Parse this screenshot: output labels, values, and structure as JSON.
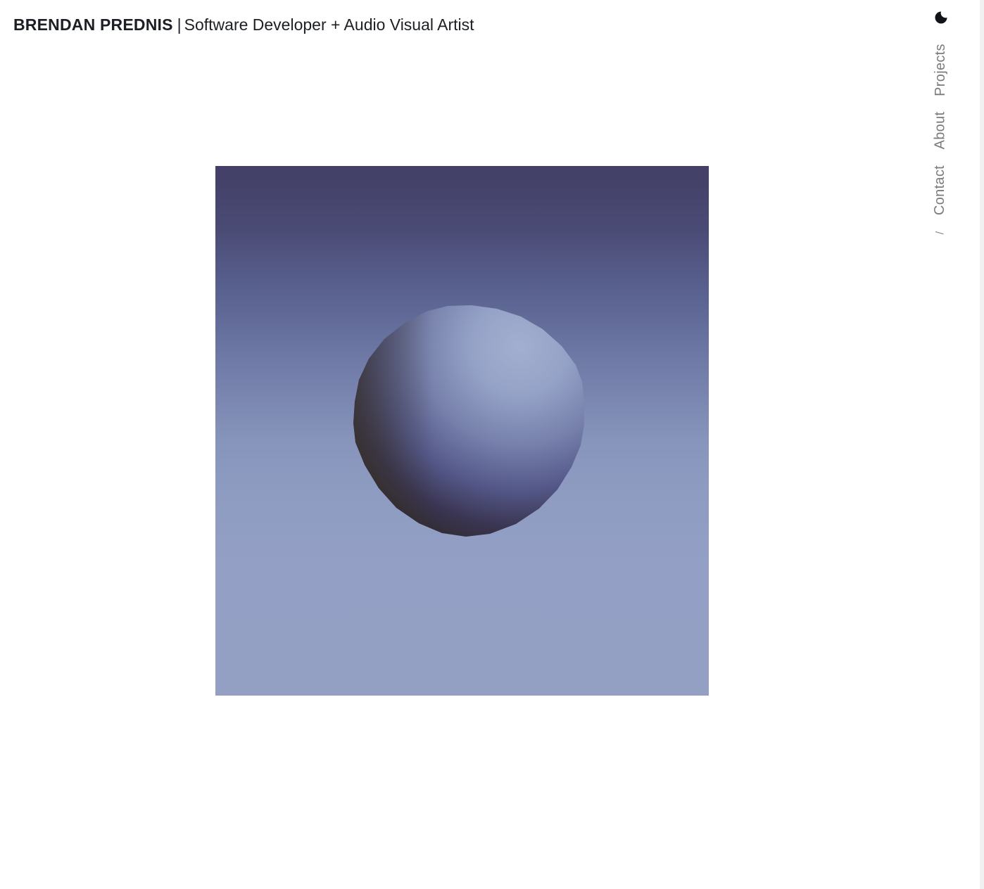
{
  "header": {
    "name": "BRENDAN PREDNIS",
    "separator": "|",
    "tagline": "Software Developer + Audio Visual Artist"
  },
  "nav": {
    "theme_icon": "moon-icon",
    "items": [
      {
        "label": "Projects"
      },
      {
        "label": "About"
      },
      {
        "label": "Contact"
      }
    ],
    "trailing": "/"
  },
  "scene": {
    "background_top": "#433f66",
    "background_bottom": "#949fc4",
    "sphere_highlight": "#a2aecd",
    "sphere_shadow": "#2a2536"
  }
}
